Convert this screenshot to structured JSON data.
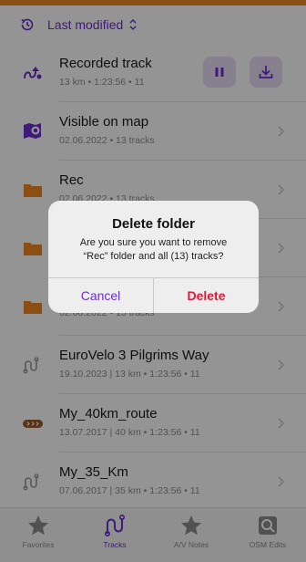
{
  "colors": {
    "accent": "#6b2fd0",
    "folder": "#ee8a22",
    "destructive": "#e0183c",
    "route": "#9b5a2a"
  },
  "sort": {
    "label": "Last modified",
    "icon": "history-icon",
    "chevron": "chevron-updown-icon"
  },
  "recorded": {
    "title": "Recorded track",
    "sub": "13 km • 1:23:56 • 11",
    "icon": "recording-icon"
  },
  "items": [
    {
      "title": "Visible on map",
      "sub": "02.06.2022 • 13 tracks",
      "icon": "map-folder-icon"
    },
    {
      "title": "Rec",
      "sub": "02.06.2022 • 13 tracks",
      "icon": "folder-icon"
    },
    {
      "title": "",
      "sub": "",
      "icon": "folder-icon"
    },
    {
      "title": "",
      "sub": "02.06.2022 • 13 tracks",
      "icon": "folder-icon"
    },
    {
      "title": "EuroVelo 3 Pilgrims Way",
      "sub": "19.10.2023 | 13 km • 1:23:56 • 11",
      "icon": "track-icon"
    },
    {
      "title": "My_40km_route",
      "sub": "13.07.2017 | 40 km • 1:23:56 • 11",
      "icon": "route-icon"
    },
    {
      "title": "My_35_Km",
      "sub": "07.06.2017 | 35 km • 1:23:56 • 11",
      "icon": "track-icon"
    }
  ],
  "tabs": [
    {
      "label": "Favorites",
      "icon": "star-icon",
      "active": false
    },
    {
      "label": "Tracks",
      "icon": "track-icon",
      "active": true
    },
    {
      "label": "A/V Notes",
      "icon": "star-icon",
      "active": false
    },
    {
      "label": "OSM Edits",
      "icon": "osm-icon",
      "active": false
    }
  ],
  "dialog": {
    "title": "Delete folder",
    "message_line1": "Are you sure you want to remove",
    "message_line2": "“Rec” folder and all (13) tracks?",
    "cancel": "Cancel",
    "delete": "Delete"
  }
}
